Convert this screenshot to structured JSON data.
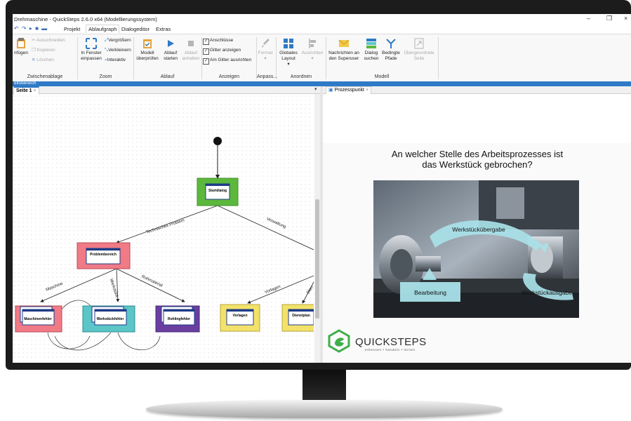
{
  "window": {
    "title": "Drehmaschine - QuickSteps 2.6.0 x64 (Modellierungssystem)",
    "minimize": "–",
    "restore": "❐",
    "close": "×"
  },
  "menu": {
    "quick_access": "↶ ↷ ▸ ■ ▬",
    "tabs": [
      "Projekt",
      "Ablaufgraph",
      "Dialogeditor",
      "Extras"
    ],
    "active_tab": "Ablaufgraph"
  },
  "ribbon": {
    "clipboard": {
      "paste": "nfügen",
      "cut": "Ausschneiden",
      "copy": "Kopieren",
      "delete": "Löschen",
      "group": "Zwischenablage"
    },
    "zoom": {
      "fit_line1": "In Fenster",
      "fit_line2": "einpassen",
      "enlarge": "Vergrößern",
      "shrink": "Verkleinern",
      "interactive": "Interaktiv",
      "group": "Zoom"
    },
    "flow": {
      "check_line1": "Modell",
      "check_line2": "überprüfen",
      "start_line1": "Ablauf",
      "start_line2": "starten",
      "stop_line1": "Ablauf",
      "stop_line2": "anhalten",
      "group": "Ablauf"
    },
    "show": {
      "connections": "Anschlüsse",
      "grid": "Gitter anzeigen",
      "snap": "Am Gitter ausrichten",
      "group": "Anzeigen"
    },
    "adapt": {
      "format": "Format",
      "format_arrow": "▾",
      "group": "Anpass..."
    },
    "arrange": {
      "global_line1": "Globales",
      "global_line2": "Layout",
      "global_arrow": "▾",
      "align": "Ausrichten",
      "align_arrow": "▾",
      "group": "Anordnen"
    },
    "model": {
      "messages_line1": "Nachrichten an",
      "messages_line2": "den Superuser",
      "dialog_line1": "Dialog",
      "dialog_line2": "suchen",
      "conditional_line1": "Bedingte",
      "conditional_line2": "Pfade",
      "parent_line1": "Übergeordnete",
      "parent_line2": "Seite",
      "group": "Modell"
    }
  },
  "workspace_label": "eitsbereich",
  "left_pane": {
    "tab": "Seite 1",
    "tab_close": "×",
    "pin": "▾"
  },
  "right_pane": {
    "tab": "Prozesspunkt",
    "tab_close": "×"
  },
  "diagram": {
    "nodes": {
      "start": "Startdialog",
      "problem": "Problembereich",
      "machine_error": "Maschinenfehler",
      "workpiece_error": "Werkstückfehler",
      "blank_error": "Rohlingfehler",
      "templates": "Vorlagen",
      "schedule": "Dienstplan"
    },
    "edges": {
      "technical": "Technisches Problem",
      "admin": "Verwaltung",
      "machine": "Maschine",
      "workpiece": "Werkstück",
      "material": "Rohmaterial",
      "templates": "Vorlagen",
      "schedule": "Dien"
    },
    "colors": {
      "start": "#5cb83c",
      "problem": "#f07b86",
      "machine": "#f07b86",
      "workpiece": "#5bc5c7",
      "blank": "#6a3fa0",
      "yellow": "#f3e26a",
      "header": "#1f3c88"
    }
  },
  "slide": {
    "question_line1": "An welcher Stelle des Arbeitsprozesses ist",
    "question_line2": "das Werkstück gebrochen?",
    "labels": {
      "transfer": "Werkstückübergabe",
      "processing": "Bearbeitung",
      "output": "Werkstückausgabe"
    },
    "logo": {
      "name": "QUICKSTEPS",
      "tagline": "erkennen  •  handeln  •  lernen",
      "color": "#3fae49"
    }
  }
}
